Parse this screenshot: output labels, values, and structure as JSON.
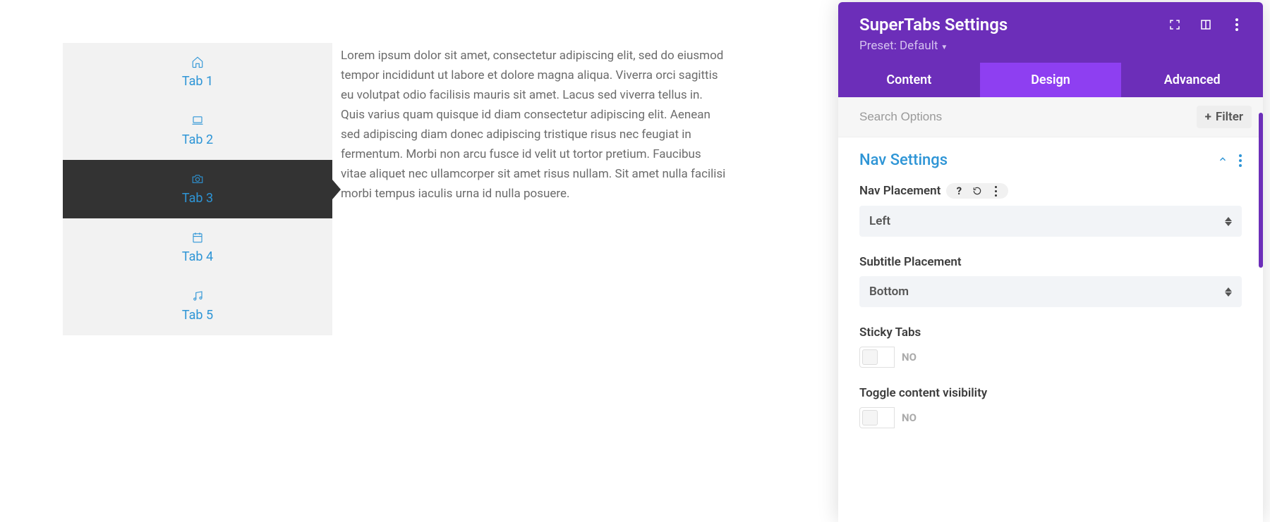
{
  "preview": {
    "tabs": [
      {
        "icon": "home-icon",
        "label": "Tab 1"
      },
      {
        "icon": "laptop-icon",
        "label": "Tab 2"
      },
      {
        "icon": "camera-icon",
        "label": "Tab 3",
        "active": true
      },
      {
        "icon": "calendar-icon",
        "label": "Tab 4"
      },
      {
        "icon": "music-icon",
        "label": "Tab 5"
      }
    ],
    "body_text": "Lorem ipsum dolor sit amet, consectetur adipiscing elit, sed do eiusmod tempor incididunt ut labore et dolore magna aliqua. Viverra orci sagittis eu volutpat odio facilisis mauris sit amet. Lacus sed viverra tellus in. Quis varius quam quisque id diam consectetur adipiscing elit. Aenean sed adipiscing diam donec adipiscing tristique risus nec feugiat in fermentum. Morbi non arcu fusce id velit ut tortor pretium. Faucibus vitae aliquet nec ullamcorper sit amet risus nullam. Sit amet nulla facilisi morbi tempus iaculis urna id nulla posuere."
  },
  "panel": {
    "title": "SuperTabs Settings",
    "preset_label": "Preset: Default",
    "tabs": {
      "content": "Content",
      "design": "Design",
      "advanced": "Advanced"
    },
    "search_placeholder": "Search Options",
    "filter_label": "Filter",
    "section_title": "Nav Settings",
    "settings": {
      "nav_placement": {
        "label": "Nav Placement",
        "value": "Left"
      },
      "subtitle_placement": {
        "label": "Subtitle Placement",
        "value": "Bottom"
      },
      "sticky_tabs": {
        "label": "Sticky Tabs",
        "value": "NO"
      },
      "toggle_visibility": {
        "label": "Toggle content visibility",
        "value": "NO"
      }
    }
  }
}
